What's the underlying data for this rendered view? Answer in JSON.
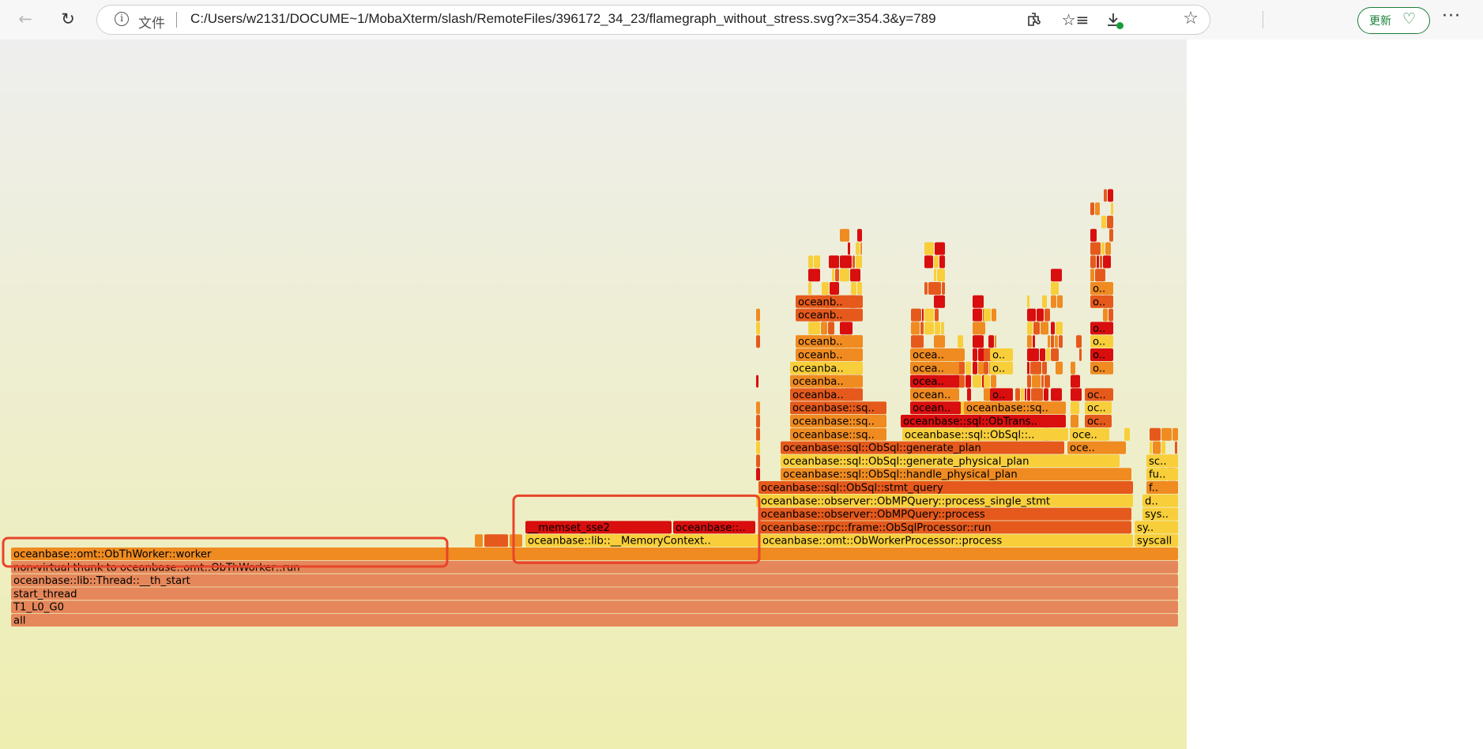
{
  "browser": {
    "site_label": "文件",
    "url": "C:/Users/w2131/DOCUME~1/MobaXterm/slash/RemoteFiles/396172_34_23/flamegraph_without_stress.svg?x=354.3&y=789",
    "update_label": "更新",
    "icons": [
      "back-arrow-icon",
      "reload-icon",
      "info-icon",
      "favorite-star-icon",
      "extensions-icon",
      "favorites-icon",
      "download-icon",
      "heart-health-icon",
      "more-icon"
    ]
  },
  "flamegraph": {
    "colors": {
      "bg_top": "#eeeeee",
      "bg_bottom": "#eeeeb0",
      "base_frame": "#e5875a",
      "yellow": "#f8cf3a",
      "orange": "#ef8b20",
      "red_orange": "#e55a1c",
      "red": "#d90e0e",
      "highlight_box": "#e8442a"
    },
    "frames": [
      {
        "label": "all",
        "color": "base"
      },
      {
        "label": "T1_L0_G0",
        "color": "base"
      },
      {
        "label": "start_thread",
        "color": "base"
      },
      {
        "label": "oceanbase::lib::Thread::__th_start",
        "color": "base"
      },
      {
        "label": "non-virtual thunk to oceanbase::omt::ObThWorker::run",
        "color": "base"
      },
      {
        "label": "oceanbase::omt::ObThWorker::worker",
        "color": "orange",
        "highlighted": true
      },
      {
        "label": "oceanbase::lib::__MemoryContext..",
        "color": "yellow"
      },
      {
        "label": "oceanbase::omt::ObWorkerProcessor::process",
        "color": "yellow"
      },
      {
        "label": "syscall",
        "color": "yellow"
      },
      {
        "label": "__memset_sse2",
        "color": "red"
      },
      {
        "label": "oceanbase::..",
        "color": "red"
      },
      {
        "label": "oceanbase::rpc::frame::ObSqlProcessor::run",
        "color": "red_orange"
      },
      {
        "label": "sy..",
        "color": "yellow"
      },
      {
        "label": "oceanbase::observer::ObMPQuery::process",
        "color": "red_orange"
      },
      {
        "label": "sys..",
        "color": "yellow"
      },
      {
        "label": "oceanbase::observer::ObMPQuery::process_single_stmt",
        "color": "yellow"
      },
      {
        "label": "d..",
        "color": "yellow"
      },
      {
        "label": "oceanbase::sql::ObSql::stmt_query",
        "color": "red_orange"
      },
      {
        "label": "f..",
        "color": "orange"
      },
      {
        "label": "oceanbase::sql::ObSql::handle_physical_plan",
        "color": "orange"
      },
      {
        "label": "fu..",
        "color": "yellow"
      },
      {
        "label": "oceanbase::sql::ObSql::generate_physical_plan",
        "color": "yellow"
      },
      {
        "label": "sc..",
        "color": "yellow"
      },
      {
        "label": "oceanbase::sql::ObSql::generate_plan",
        "color": "red_orange"
      },
      {
        "label": "oce..",
        "color": "orange"
      },
      {
        "label": "oceanbase::sq..",
        "color": "orange"
      },
      {
        "label": "oceanbase::sql::ObSql::..",
        "color": "yellow"
      },
      {
        "label": "oce..",
        "color": "yellow"
      },
      {
        "label": "oceanbase::sq..",
        "color": "orange"
      },
      {
        "label": "oceanbase::sql::ObTrans..",
        "color": "red"
      },
      {
        "label": "oc..",
        "color": "red_orange"
      },
      {
        "label": "oceanbase::sq..",
        "color": "red_orange"
      },
      {
        "label": "ocean..",
        "color": "red"
      },
      {
        "label": "oceanbase::sq..",
        "color": "orange"
      },
      {
        "label": "oc..",
        "color": "yellow"
      },
      {
        "label": "oceanba..",
        "color": "red_orange"
      },
      {
        "label": "ocean..",
        "color": "orange"
      },
      {
        "label": "o..",
        "color": "red"
      },
      {
        "label": "oc..",
        "color": "red_orange"
      },
      {
        "label": "oceanba..",
        "color": "orange"
      },
      {
        "label": "ocea..",
        "color": "red"
      },
      {
        "label": "oceanba..",
        "color": "yellow"
      },
      {
        "label": "ocea..",
        "color": "orange"
      },
      {
        "label": "o..",
        "color": "yellow"
      },
      {
        "label": "o..",
        "color": "orange"
      },
      {
        "label": "oceanb..",
        "color": "orange"
      },
      {
        "label": "ocea..",
        "color": "orange"
      },
      {
        "label": "o..",
        "color": "yellow"
      },
      {
        "label": "o..",
        "color": "red"
      },
      {
        "label": "oceanb..",
        "color": "orange"
      },
      {
        "label": "o..",
        "color": "yellow"
      },
      {
        "label": "o..",
        "color": "red"
      },
      {
        "label": "oceanb..",
        "color": "red_orange"
      },
      {
        "label": "o..",
        "color": "red_orange"
      },
      {
        "label": "oceanb..",
        "color": "red_orange"
      },
      {
        "label": "o..",
        "color": "orange"
      }
    ]
  }
}
